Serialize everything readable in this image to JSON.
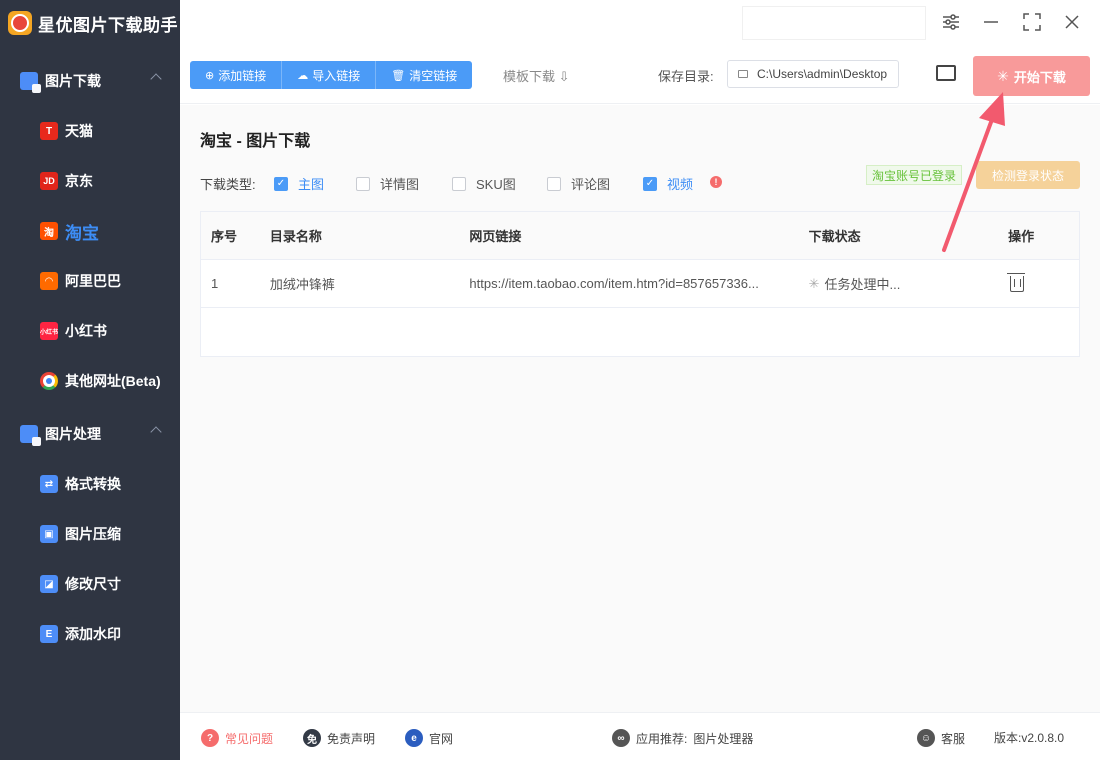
{
  "app": {
    "title": "星优图片下载助手"
  },
  "sidebar": {
    "groups": [
      {
        "label": "图片下载",
        "items": [
          {
            "label": "天猫",
            "icon": "tmall-icon",
            "glyph": "T"
          },
          {
            "label": "京东",
            "icon": "jd-icon",
            "glyph": "JD"
          },
          {
            "label": "淘宝",
            "icon": "taobao-icon",
            "glyph": "淘",
            "active": true
          },
          {
            "label": "阿里巴巴",
            "icon": "alibaba-icon",
            "glyph": "◠"
          },
          {
            "label": "小红书",
            "icon": "xiaohongshu-icon",
            "glyph": "小红书"
          },
          {
            "label": "其他网址(Beta)",
            "icon": "chrome-icon",
            "glyph": ""
          }
        ]
      },
      {
        "label": "图片处理",
        "items": [
          {
            "label": "格式转换",
            "icon": "format-convert-icon",
            "glyph": "⇄"
          },
          {
            "label": "图片压缩",
            "icon": "image-compress-icon",
            "glyph": "▣"
          },
          {
            "label": "修改尺寸",
            "icon": "resize-icon",
            "glyph": "◪"
          },
          {
            "label": "添加水印",
            "icon": "watermark-icon",
            "glyph": "E"
          }
        ]
      }
    ]
  },
  "toolbar": {
    "add_link": "添加链接",
    "import_link": "导入链接",
    "clear_link": "清空链接",
    "template": "模板下载 ⇩",
    "save_dir_label": "保存目录:",
    "save_dir_value": "C:\\Users\\admin\\Desktop",
    "start_download": "开始下载"
  },
  "main": {
    "title": "淘宝 - 图片下载",
    "download_type_label": "下载类型:",
    "types": [
      {
        "label": "主图",
        "checked": true
      },
      {
        "label": "详情图",
        "checked": false
      },
      {
        "label": "SKU图",
        "checked": false
      },
      {
        "label": "评论图",
        "checked": false
      },
      {
        "label": "视频",
        "checked": true
      }
    ],
    "login_status": "淘宝账号已登录",
    "check_login": "检测登录状态",
    "table": {
      "headers": [
        "序号",
        "目录名称",
        "网页链接",
        "下载状态",
        "操作"
      ],
      "rows": [
        {
          "index": "1",
          "name": "加绒冲锋裤",
          "url": "https://item.taobao.com/item.htm?id=857657336...",
          "status": "任务处理中..."
        }
      ]
    }
  },
  "footer": {
    "faq": "常见问题",
    "disclaimer": "免责声明",
    "website": "官网",
    "recommend_label": "应用推荐:",
    "recommend_value": "图片处理器",
    "support": "客服",
    "version": "版本:v2.0.8.0"
  },
  "colors": {
    "sidebar_bg": "#2f3542",
    "accent": "#4b9bf7",
    "start_button": "#f89a9a",
    "arrow": "#f25a6e"
  }
}
